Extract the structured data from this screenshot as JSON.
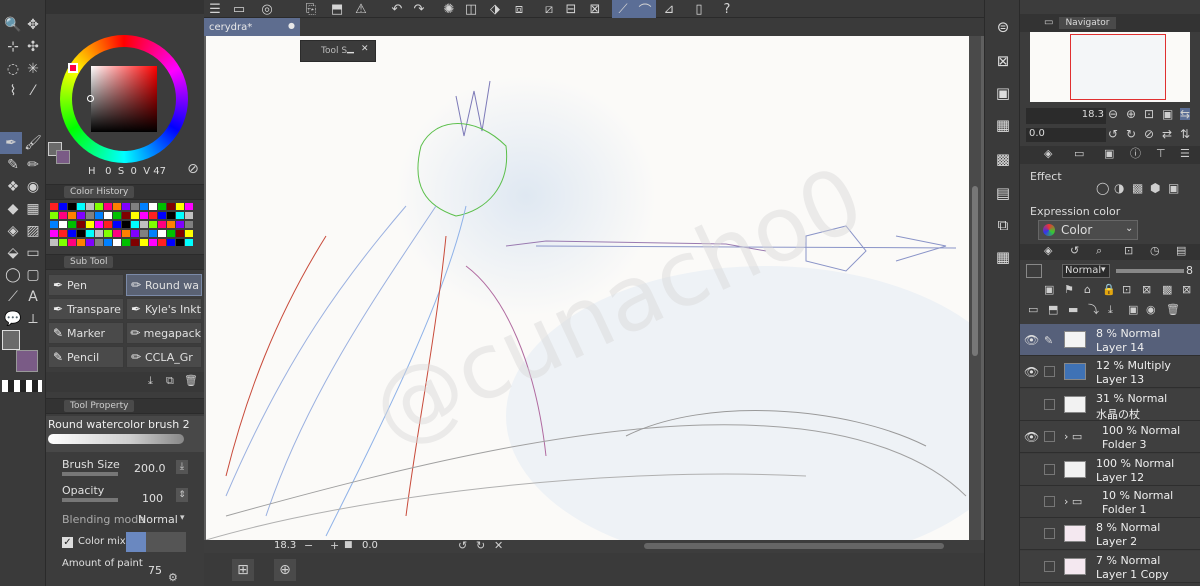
{
  "document": {
    "tab_title": "cerydra*"
  },
  "floating_tool": {
    "label": "Tool S"
  },
  "color": {
    "h": "H",
    "s_label": "0",
    "v_label": "S",
    "h_value": "0",
    "s_value": "0",
    "v_value": "V",
    "v_num": "47"
  },
  "panels": {
    "color_history": "Color History",
    "sub_tool": "Sub Tool",
    "tool_property": "Tool Property",
    "navigator": "Navigator"
  },
  "subtools": [
    {
      "label": "Pen"
    },
    {
      "label": "Round wa"
    },
    {
      "label": "Transpare"
    },
    {
      "label": "Kyle's Inkt"
    },
    {
      "label": "Marker"
    },
    {
      "label": "megapack"
    },
    {
      "label": "Pencil"
    },
    {
      "label": "CCLA_Gr"
    }
  ],
  "tool_property": {
    "brush_name": "Round watercolor brush 2",
    "brush_size_label": "Brush Size",
    "brush_size_value": "200.0",
    "opacity_label": "Opacity",
    "opacity_value": "100",
    "blending_label": "Blending mode",
    "blending_value": "Normal",
    "color_mixing_label": "Color mixin",
    "amount_label": "Amount of paint",
    "amount_value": "75"
  },
  "canvas_bottom": {
    "zoom": "18.3",
    "rotation": "0.0"
  },
  "navigator": {
    "zoom": "18.3",
    "rotation": "0.0"
  },
  "property": {
    "effect_label": "Effect",
    "expression_label": "Expression color",
    "expression_value": "Color"
  },
  "layer_panel": {
    "blend": "Normal",
    "opacity_num": "8"
  },
  "layers": [
    {
      "pct": "8 % Normal",
      "name": "Layer 14",
      "eye": true,
      "selected": true,
      "folder": false
    },
    {
      "pct": "12 % Multiply",
      "name": "Layer 13",
      "eye": true,
      "selected": false,
      "folder": false
    },
    {
      "pct": "31 % Normal",
      "name": "水晶の杖",
      "eye": false,
      "selected": false,
      "folder": false
    },
    {
      "pct": "100 % Normal",
      "name": "Folder 3",
      "eye": true,
      "selected": false,
      "folder": true
    },
    {
      "pct": "100 % Normal",
      "name": "Layer 12",
      "eye": false,
      "selected": false,
      "folder": false
    },
    {
      "pct": "10 % Normal",
      "name": "Folder 1",
      "eye": false,
      "selected": false,
      "folder": true
    },
    {
      "pct": "8 % Normal",
      "name": "Layer 2",
      "eye": false,
      "selected": false,
      "folder": false
    },
    {
      "pct": "7 % Normal",
      "name": "Layer 1 Copy",
      "eye": false,
      "selected": false,
      "folder": false
    }
  ],
  "icons": {
    "tools": [
      "zoom-icon",
      "move-icon",
      "lasso-icon",
      "select-icon",
      "eyedropper-icon",
      "wand-icon",
      "pen-icon",
      "brush-icon",
      "airbrush-icon",
      "eraser-icon",
      "blend-icon",
      "fill-icon",
      "gradient-icon",
      "figure-icon",
      "frame-icon",
      "text-icon",
      "ruler-icon",
      "balloon-icon"
    ]
  }
}
